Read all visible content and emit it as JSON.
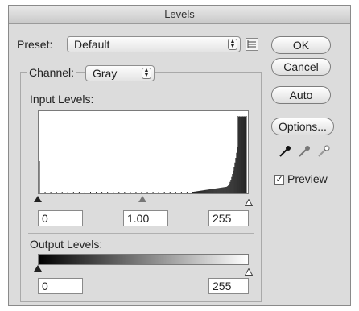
{
  "window": {
    "title": "Levels"
  },
  "preset": {
    "label": "Preset:",
    "value": "Default"
  },
  "channel": {
    "label": "Channel:",
    "value": "Gray"
  },
  "input_levels": {
    "label": "Input Levels:",
    "black": "0",
    "gamma": "1.00",
    "white": "255"
  },
  "output_levels": {
    "label": "Output Levels:",
    "black": "0",
    "white": "255"
  },
  "buttons": {
    "ok": "OK",
    "cancel": "Cancel",
    "auto": "Auto",
    "options": "Options..."
  },
  "preview": {
    "label": "Preview",
    "checked": true
  },
  "icons": {
    "preset_menu": "list-menu-icon",
    "eyedroppers": [
      "black-eyedropper-icon",
      "gray-eyedropper-icon",
      "white-eyedropper-icon"
    ]
  }
}
